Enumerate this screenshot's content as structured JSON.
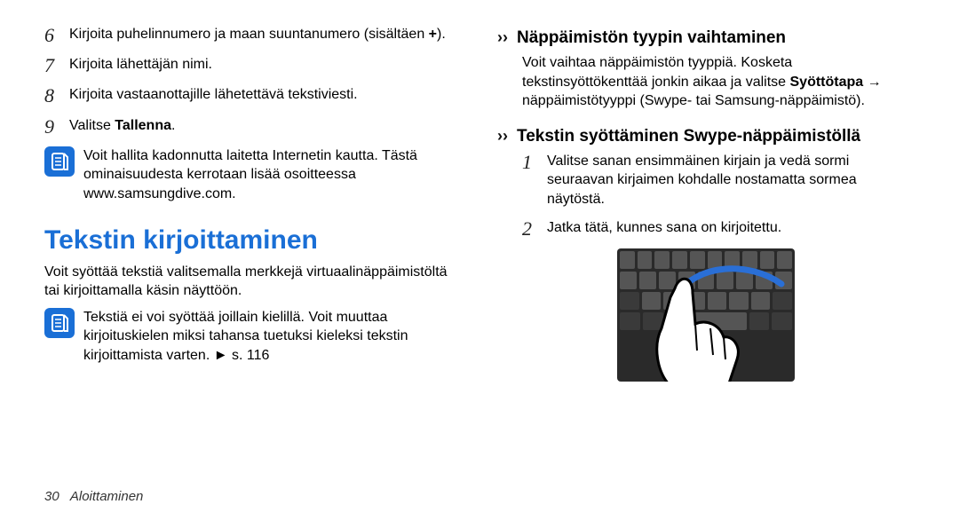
{
  "left": {
    "items": [
      {
        "num": "6",
        "text_parts": [
          "Kirjoita puhelinnumero ja maan suuntanumero (sisältäen ",
          "+",
          ")."
        ]
      },
      {
        "num": "7",
        "text": "Kirjoita lähettäjän nimi."
      },
      {
        "num": "8",
        "text": "Kirjoita vastaanottajille lähetettävä tekstiviesti."
      },
      {
        "num": "9",
        "text_prefix": "Valitse ",
        "text_bold": "Tallenna",
        "text_suffix": "."
      }
    ],
    "note1": "Voit hallita kadonnutta laitetta Internetin kautta. Tästä ominaisuudesta kerrotaan lisää osoitteessa www.samsungdive.com.",
    "heading": "Tekstin kirjoittaminen",
    "body": "Voit syöttää tekstiä valitsemalla merkkejä virtuaalinäppäimistöltä tai kirjoittamalla käsin näyttöön.",
    "note2": "Tekstiä ei voi syöttää joillain kielillä. Voit muuttaa kirjoituskielen miksi tahansa tuetuksi kieleksi tekstin kirjoittamista varten. ► s. 116"
  },
  "right": {
    "sub1": "Näppäimistön tyypin vaihtaminen",
    "body1_parts": [
      "Voit vaihtaa näppäimistön tyyppiä. Kosketa tekstinsyöttökenttää jonkin aikaa ja valitse ",
      "Syöttötapa",
      " → näppäimistötyyppi (Swype- tai Samsung-näppäimistö)."
    ],
    "sub2": "Tekstin syöttäminen Swype-näppäimistöllä",
    "steps": [
      {
        "num": "1",
        "text": "Valitse sanan ensimmäinen kirjain ja vedä sormi seuraavan kirjaimen kohdalle nostamatta sormea näytöstä."
      },
      {
        "num": "2",
        "text": "Jatka tätä, kunnes sana on kirjoitettu."
      }
    ]
  },
  "footer": {
    "page_num": "30",
    "section": "Aloittaminen"
  }
}
